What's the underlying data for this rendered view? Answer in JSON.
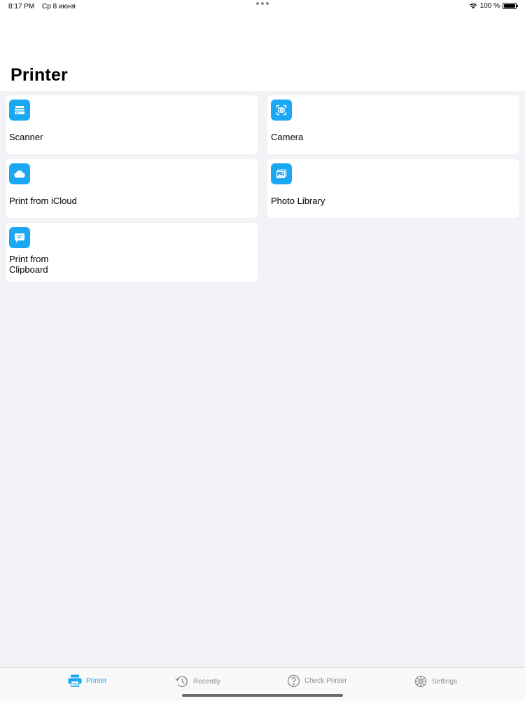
{
  "status_bar": {
    "time": "8:17 PM",
    "date": "Ср 8 июня",
    "battery": "100 %"
  },
  "header": {
    "title": "Printer"
  },
  "tiles": [
    {
      "label": "Scanner",
      "icon": "scanner-icon"
    },
    {
      "label": "Camera",
      "icon": "camera-icon"
    },
    {
      "label": "Print from iCloud",
      "icon": "cloud-icon"
    },
    {
      "label": "Photo Library",
      "icon": "photo-library-icon"
    },
    {
      "label": "Print from\nClipboard",
      "icon": "clipboard-icon"
    }
  ],
  "tab_bar": {
    "tabs": [
      {
        "label": "Printer",
        "icon": "printer-icon",
        "active": true
      },
      {
        "label": "Recently",
        "icon": "history-icon",
        "active": false
      },
      {
        "label": "Check Printer",
        "icon": "question-icon",
        "active": false
      },
      {
        "label": "Settings",
        "icon": "gear-icon",
        "active": false
      }
    ]
  },
  "colors": {
    "accent": "#1aa8f2",
    "background": "#f2f2f7",
    "inactive_tab": "#8e8e93"
  }
}
